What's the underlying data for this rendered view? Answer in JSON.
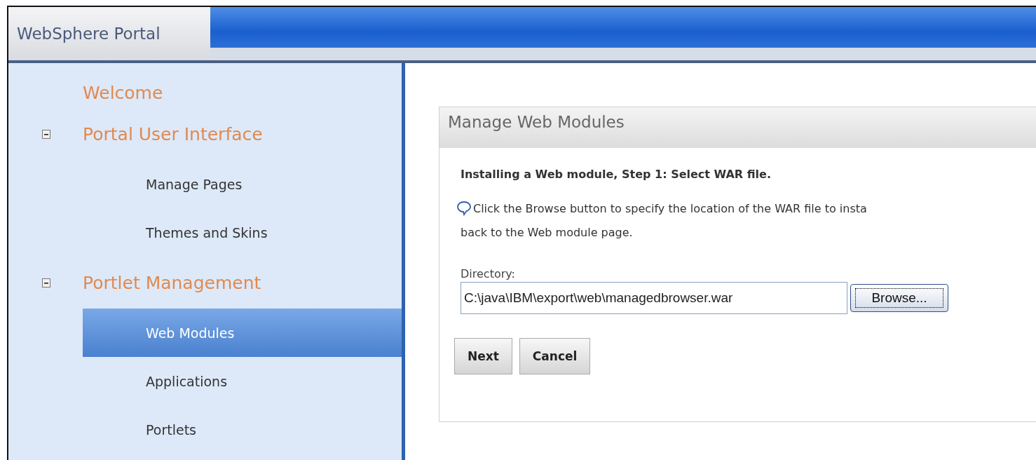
{
  "header": {
    "title": "WebSphere Portal"
  },
  "nav": [
    {
      "label": "Welcome",
      "kind": "link"
    },
    {
      "label": "Portal User Interface",
      "kind": "group",
      "expanded": true,
      "children": [
        {
          "label": "Manage Pages",
          "selected": false
        },
        {
          "label": "Themes and Skins",
          "selected": false
        }
      ]
    },
    {
      "label": "Portlet Management",
      "kind": "group",
      "expanded": true,
      "children": [
        {
          "label": "Web Modules",
          "selected": true
        },
        {
          "label": "Applications",
          "selected": false
        },
        {
          "label": "Portlets",
          "selected": false
        }
      ]
    }
  ],
  "panel": {
    "title": "Manage Web Modules",
    "step": "Installing a Web module, Step 1: Select WAR file.",
    "info_lines": [
      "Click the Browse button to specify the location of the WAR file to insta",
      "back to the Web module page."
    ],
    "directory": {
      "label": "Directory:",
      "value": "C:\\java\\IBM\\export\\web\\managedbrowser.war",
      "browse": "Browse..."
    },
    "buttons": [
      "Next",
      "Cancel"
    ]
  }
}
